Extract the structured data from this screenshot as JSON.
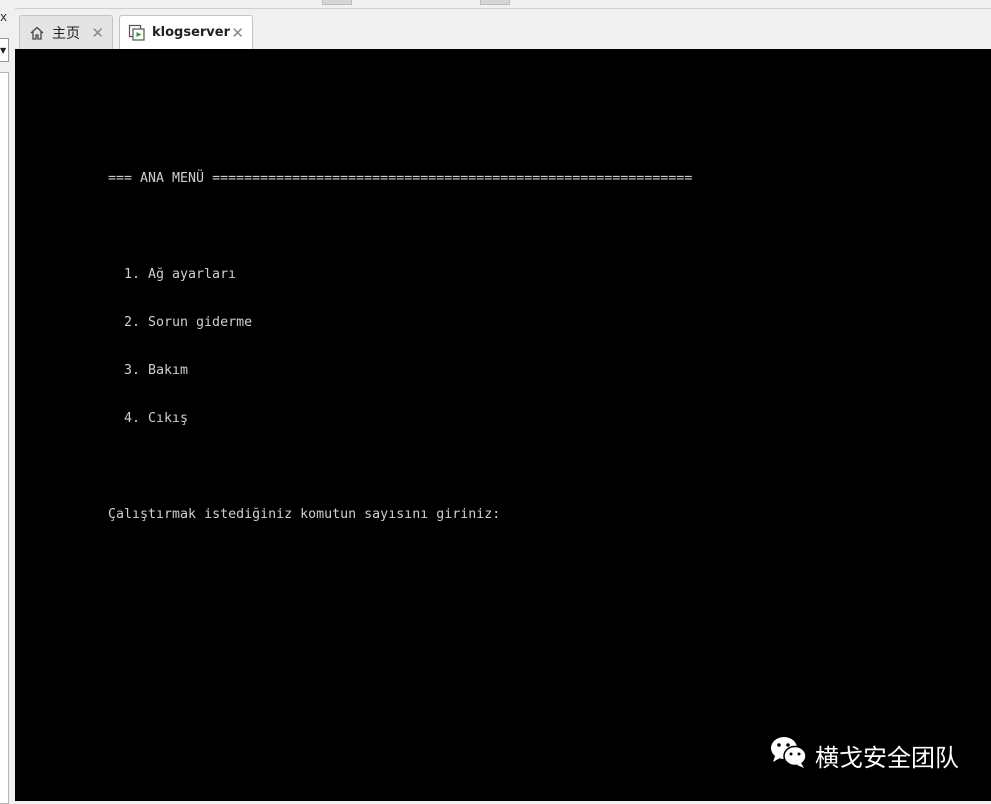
{
  "window": {
    "left_close_glyph": "x"
  },
  "tabs": [
    {
      "label": "主页",
      "icon": "home-icon"
    },
    {
      "label": "klogserver",
      "icon": "vm-running-icon"
    }
  ],
  "console": {
    "menu_header": "=== ANA MENÜ ============================================================",
    "items": [
      "1. Ağ ayarları",
      "2. Sorun giderme",
      "3. Bakım",
      "4. Cıkış"
    ],
    "prompt": "Çalıştırmak istediğiniz komutun sayısını giriniz:"
  },
  "watermark": {
    "text": "横戈安全团队",
    "icon": "wechat-icon"
  },
  "colors": {
    "console_bg": "#000000",
    "console_text": "#cfcfcf",
    "chrome_bg": "#f0f0f0",
    "vm_icon_green": "#2e9e3a"
  }
}
